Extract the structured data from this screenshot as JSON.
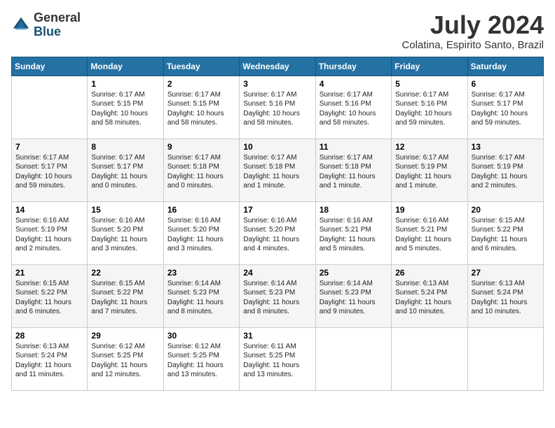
{
  "header": {
    "logo_general": "General",
    "logo_blue": "Blue",
    "month_year": "July 2024",
    "location": "Colatina, Espirito Santo, Brazil"
  },
  "days_of_week": [
    "Sunday",
    "Monday",
    "Tuesday",
    "Wednesday",
    "Thursday",
    "Friday",
    "Saturday"
  ],
  "weeks": [
    [
      {
        "day": "",
        "info": ""
      },
      {
        "day": "1",
        "info": "Sunrise: 6:17 AM\nSunset: 5:15 PM\nDaylight: 10 hours\nand 58 minutes."
      },
      {
        "day": "2",
        "info": "Sunrise: 6:17 AM\nSunset: 5:15 PM\nDaylight: 10 hours\nand 58 minutes."
      },
      {
        "day": "3",
        "info": "Sunrise: 6:17 AM\nSunset: 5:16 PM\nDaylight: 10 hours\nand 58 minutes."
      },
      {
        "day": "4",
        "info": "Sunrise: 6:17 AM\nSunset: 5:16 PM\nDaylight: 10 hours\nand 58 minutes."
      },
      {
        "day": "5",
        "info": "Sunrise: 6:17 AM\nSunset: 5:16 PM\nDaylight: 10 hours\nand 59 minutes."
      },
      {
        "day": "6",
        "info": "Sunrise: 6:17 AM\nSunset: 5:17 PM\nDaylight: 10 hours\nand 59 minutes."
      }
    ],
    [
      {
        "day": "7",
        "info": "Sunrise: 6:17 AM\nSunset: 5:17 PM\nDaylight: 10 hours\nand 59 minutes."
      },
      {
        "day": "8",
        "info": "Sunrise: 6:17 AM\nSunset: 5:17 PM\nDaylight: 11 hours\nand 0 minutes."
      },
      {
        "day": "9",
        "info": "Sunrise: 6:17 AM\nSunset: 5:18 PM\nDaylight: 11 hours\nand 0 minutes."
      },
      {
        "day": "10",
        "info": "Sunrise: 6:17 AM\nSunset: 5:18 PM\nDaylight: 11 hours\nand 1 minute."
      },
      {
        "day": "11",
        "info": "Sunrise: 6:17 AM\nSunset: 5:18 PM\nDaylight: 11 hours\nand 1 minute."
      },
      {
        "day": "12",
        "info": "Sunrise: 6:17 AM\nSunset: 5:19 PM\nDaylight: 11 hours\nand 1 minute."
      },
      {
        "day": "13",
        "info": "Sunrise: 6:17 AM\nSunset: 5:19 PM\nDaylight: 11 hours\nand 2 minutes."
      }
    ],
    [
      {
        "day": "14",
        "info": "Sunrise: 6:16 AM\nSunset: 5:19 PM\nDaylight: 11 hours\nand 2 minutes."
      },
      {
        "day": "15",
        "info": "Sunrise: 6:16 AM\nSunset: 5:20 PM\nDaylight: 11 hours\nand 3 minutes."
      },
      {
        "day": "16",
        "info": "Sunrise: 6:16 AM\nSunset: 5:20 PM\nDaylight: 11 hours\nand 3 minutes."
      },
      {
        "day": "17",
        "info": "Sunrise: 6:16 AM\nSunset: 5:20 PM\nDaylight: 11 hours\nand 4 minutes."
      },
      {
        "day": "18",
        "info": "Sunrise: 6:16 AM\nSunset: 5:21 PM\nDaylight: 11 hours\nand 5 minutes."
      },
      {
        "day": "19",
        "info": "Sunrise: 6:16 AM\nSunset: 5:21 PM\nDaylight: 11 hours\nand 5 minutes."
      },
      {
        "day": "20",
        "info": "Sunrise: 6:15 AM\nSunset: 5:22 PM\nDaylight: 11 hours\nand 6 minutes."
      }
    ],
    [
      {
        "day": "21",
        "info": "Sunrise: 6:15 AM\nSunset: 5:22 PM\nDaylight: 11 hours\nand 6 minutes."
      },
      {
        "day": "22",
        "info": "Sunrise: 6:15 AM\nSunset: 5:22 PM\nDaylight: 11 hours\nand 7 minutes."
      },
      {
        "day": "23",
        "info": "Sunrise: 6:14 AM\nSunset: 5:23 PM\nDaylight: 11 hours\nand 8 minutes."
      },
      {
        "day": "24",
        "info": "Sunrise: 6:14 AM\nSunset: 5:23 PM\nDaylight: 11 hours\nand 8 minutes."
      },
      {
        "day": "25",
        "info": "Sunrise: 6:14 AM\nSunset: 5:23 PM\nDaylight: 11 hours\nand 9 minutes."
      },
      {
        "day": "26",
        "info": "Sunrise: 6:13 AM\nSunset: 5:24 PM\nDaylight: 11 hours\nand 10 minutes."
      },
      {
        "day": "27",
        "info": "Sunrise: 6:13 AM\nSunset: 5:24 PM\nDaylight: 11 hours\nand 10 minutes."
      }
    ],
    [
      {
        "day": "28",
        "info": "Sunrise: 6:13 AM\nSunset: 5:24 PM\nDaylight: 11 hours\nand 11 minutes."
      },
      {
        "day": "29",
        "info": "Sunrise: 6:12 AM\nSunset: 5:25 PM\nDaylight: 11 hours\nand 12 minutes."
      },
      {
        "day": "30",
        "info": "Sunrise: 6:12 AM\nSunset: 5:25 PM\nDaylight: 11 hours\nand 13 minutes."
      },
      {
        "day": "31",
        "info": "Sunrise: 6:11 AM\nSunset: 5:25 PM\nDaylight: 11 hours\nand 13 minutes."
      },
      {
        "day": "",
        "info": ""
      },
      {
        "day": "",
        "info": ""
      },
      {
        "day": "",
        "info": ""
      }
    ]
  ]
}
